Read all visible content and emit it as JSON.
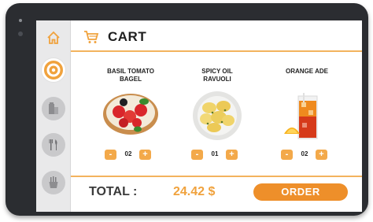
{
  "header": {
    "title": "CART",
    "icon": "cart-icon"
  },
  "sidebar": {
    "items": [
      {
        "icon": "home-icon"
      },
      {
        "icon": "donut-icon",
        "active": true
      },
      {
        "icon": "drink-icon"
      },
      {
        "icon": "cutlery-icon"
      },
      {
        "icon": "fries-icon"
      }
    ]
  },
  "items": [
    {
      "name_line1": "BASIL TOMATO",
      "name_line2": "BAGEL",
      "minus": "-",
      "qty": "02",
      "plus": "+",
      "image": "bagel-image"
    },
    {
      "name_line1": "SPICY OIL",
      "name_line2": "RAVUOLI",
      "minus": "-",
      "qty": "01",
      "plus": "+",
      "image": "ravioli-image"
    },
    {
      "name_line1": "ORANGE ADE",
      "name_line2": "",
      "minus": "-",
      "qty": "02",
      "plus": "+",
      "image": "orange-ade-image"
    }
  ],
  "footer": {
    "total_label": "TOTAL :",
    "total_value": "24.42 $",
    "order_label": "ORDER"
  },
  "colors": {
    "accent": "#f0a23d",
    "order": "#ee8f2a",
    "bezel": "#2b2d31"
  }
}
